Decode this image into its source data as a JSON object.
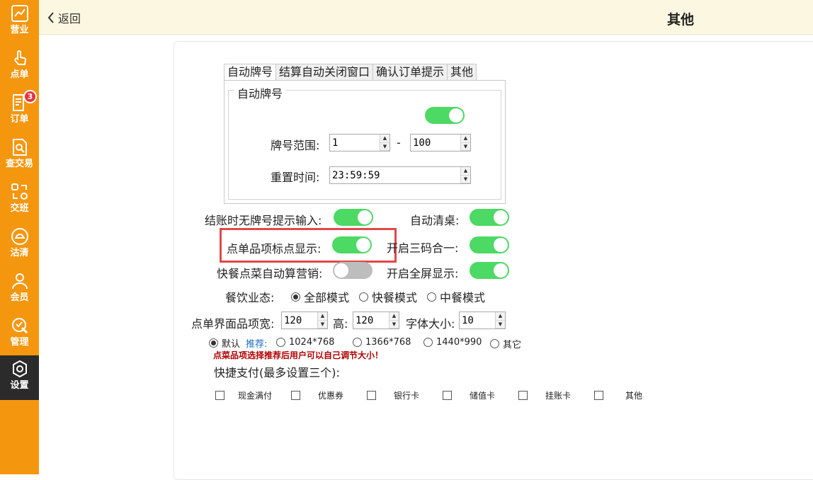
{
  "sidebar": {
    "items": [
      {
        "label": "营业",
        "icon": "chart-icon"
      },
      {
        "label": "点单",
        "icon": "tap-hand-icon"
      },
      {
        "label": "订单",
        "icon": "order-icon"
      },
      {
        "label": "查交易",
        "icon": "search-doc-icon"
      },
      {
        "label": "交班",
        "icon": "shift-icon"
      },
      {
        "label": "沽清",
        "icon": "dish-icon"
      },
      {
        "label": "会员",
        "icon": "member-icon"
      },
      {
        "label": "管理",
        "icon": "wrench-icon"
      },
      {
        "label": "设置",
        "icon": "settings-icon"
      }
    ],
    "active": "设置",
    "order_badge": "3",
    "accent": "#f5960f"
  },
  "header": {
    "back_label": "返回",
    "title": "其他"
  },
  "tabs": [
    "自动牌号",
    "结算自动关闭窗口",
    "确认订单提示",
    "其他"
  ],
  "auto_number": {
    "group_title": "自动牌号",
    "enabled": true,
    "range_label": "牌号范围:",
    "range_from": "1",
    "range_sep": "-",
    "range_to": "100",
    "reset_label": "重置时间:",
    "reset_time": "23:59:59"
  },
  "options": {
    "no_number_prompt": {
      "label": "结账时无牌号提示输入:",
      "on": true
    },
    "auto_clear_table": {
      "label": "自动清桌:",
      "on": true
    },
    "item_marker": {
      "label": "点单品项标点显示:",
      "on": true
    },
    "three_in_one": {
      "label": "开启三码合一:",
      "on": true
    },
    "fast_auto_promo": {
      "label": "快餐点菜自动算营销:",
      "on": false
    },
    "fullscreen": {
      "label": "开启全屏显示:",
      "on": true
    }
  },
  "business_mode": {
    "label": "餐饮业态:",
    "options": [
      "全部模式",
      "快餐模式",
      "中餐模式"
    ],
    "selected": "全部模式"
  },
  "item_size": {
    "width_label": "点单界面品项宽:",
    "width": "120",
    "height_label": "高:",
    "height": "120",
    "font_label": "字体大小:",
    "font": "10"
  },
  "resolution": {
    "default_label": "默认",
    "recommend_label": "推荐:",
    "options": [
      "1024*768",
      "1366*768",
      "1440*990",
      "其它"
    ],
    "selected": "默认",
    "tip": "点菜品项选择推荐后用户可以自己调节大小！"
  },
  "quick_pay": {
    "label": "快捷支付(最多设置三个):",
    "items": [
      "现金满付",
      "优惠券",
      "银行卡",
      "储值卡",
      "挂账卡",
      "其他"
    ]
  }
}
